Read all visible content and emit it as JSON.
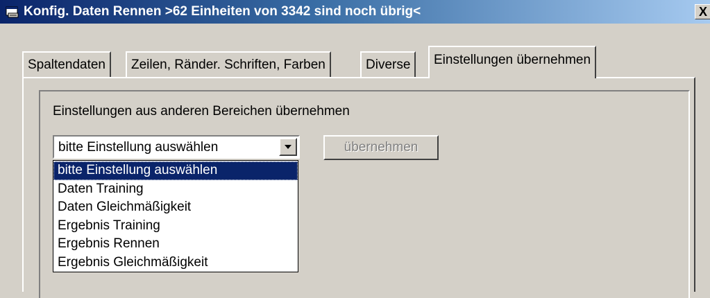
{
  "window": {
    "title": "Konfig. Daten Rennen >62 Einheiten von 3342 sind noch übrig<",
    "close_label": "X",
    "icon": "app-icon"
  },
  "tabs": [
    {
      "label": "Spaltendaten",
      "active": false
    },
    {
      "label": "Zeilen, Ränder. Schriften, Farben",
      "active": false
    },
    {
      "label": "Diverse",
      "active": false
    },
    {
      "label": "Einstellungen übernehmen",
      "active": true
    }
  ],
  "panel": {
    "section_label": "Einstellungen aus anderen Bereichen übernehmen",
    "combo": {
      "selected_value": "bitte Einstellung auswählen",
      "arrow_icon": "chevron-down-icon"
    },
    "apply_button": {
      "label": "übernehmen",
      "enabled": false
    },
    "dropdown_options": [
      "bitte Einstellung auswählen",
      "Daten Training",
      "Daten Gleichmäßigkeit",
      "Ergebnis Training",
      "Ergebnis Rennen",
      "Ergebnis Gleichmäßigkeit"
    ],
    "dropdown_highlighted_index": 0
  },
  "colors": {
    "titlebar_start": "#0a246a",
    "titlebar_end": "#a6caf0",
    "face": "#d4d0c8",
    "highlight": "#0a246a"
  }
}
